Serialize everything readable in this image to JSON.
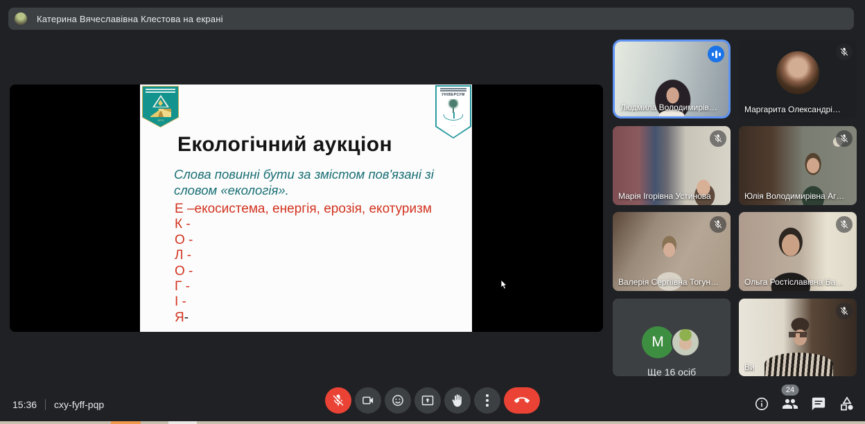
{
  "banner": {
    "text": "Катерина Вячеславівна Клестова на екрані"
  },
  "slide": {
    "title": "Екологічний аукціон",
    "subtitle_line1": "Слова повинні бути за змістом пов'язані зі",
    "subtitle_line2": "словом «екологія».",
    "letter_lines": [
      "Е –екосистема, енергія, ерозія, екотуризм",
      "К -",
      "О -",
      "Л -",
      "О -",
      "Г -",
      "І -"
    ],
    "last_line_letter": "Я",
    "last_line_dash": "-",
    "logo_right_text": "УНІВЕРСУМ"
  },
  "participants": [
    {
      "name": "Людмила Володимирів…"
    },
    {
      "name": "Маргарита Олександрі…"
    },
    {
      "name": "Марія Ігорівна Устинова"
    },
    {
      "name": "Юлія Володимирівна Аг…"
    },
    {
      "name": "Валерія Сергіївна Тогун…"
    },
    {
      "name": "Ольга Ростіславівна Ба…"
    },
    {
      "name": "Ще 16 осіб",
      "avatar_letter": "M"
    },
    {
      "name": "Ви"
    }
  ],
  "statusbar": {
    "time": "15:36",
    "meeting_code": "cxy-fyff-pqp"
  },
  "panel": {
    "participants_count": "24"
  },
  "colors": {
    "background": "#202124",
    "surface": "#3c4043",
    "accent_blue": "#1a73e8",
    "active_border": "#5f94f5",
    "danger_red": "#ea4335",
    "slide_red": "#d2331f",
    "slide_teal": "#186e74"
  }
}
